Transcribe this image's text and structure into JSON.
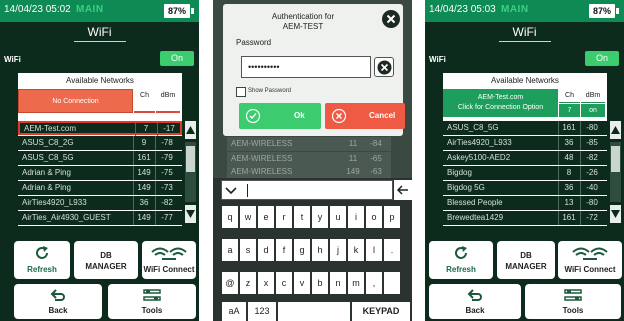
{
  "screens": [
    {
      "status": {
        "time": "14/04/23 05:02",
        "mode": "MAIN",
        "battery": "87%"
      },
      "title": "WiFi",
      "wifi_label": "WiFi",
      "toggle": "On",
      "networks": {
        "heading": "Available Networks",
        "header_left": "No Connection",
        "col_ch": "Ch",
        "col_dbm": "dBm",
        "rows": [
          {
            "name": "AEM-Test.com",
            "ch": "7",
            "dbm": "-17"
          },
          {
            "name": "ASUS_C8_2G",
            "ch": "9",
            "dbm": "-78"
          },
          {
            "name": "ASUS_C8_5G",
            "ch": "161",
            "dbm": "-79"
          },
          {
            "name": "Adrian & Ping",
            "ch": "149",
            "dbm": "-75"
          },
          {
            "name": "Adrian & Ping",
            "ch": "149",
            "dbm": "-73"
          },
          {
            "name": "AirTies4920_L933",
            "ch": "36",
            "dbm": "-82"
          },
          {
            "name": "AirTies_Air4930_GUEST",
            "ch": "149",
            "dbm": "-77"
          }
        ]
      },
      "buttons": {
        "refresh": "Refresh",
        "db_line1": "DB",
        "db_line2": "MANAGER",
        "wifi_connect": "WiFi Connect",
        "back": "Back",
        "tools": "Tools"
      }
    },
    {
      "dialog": {
        "title_line1": "Authentication for",
        "title_line2": "AEM-TEST",
        "password_label": "Password",
        "password_value": "••••••••••",
        "show_password": "Show Password",
        "ok": "Ok",
        "cancel": "Cancel"
      },
      "background_rows": [
        {
          "name": "AEM-WIRELESS",
          "ch": "11",
          "dbm": "-84"
        },
        {
          "name": "AEM-WIRELESS",
          "ch": "11",
          "dbm": "-65"
        },
        {
          "name": "AEM-WIRELESS",
          "ch": "149",
          "dbm": "-63"
        }
      ],
      "keyboard": {
        "row1": [
          "q",
          "w",
          "e",
          "r",
          "t",
          "y",
          "u",
          "i",
          "o",
          "p"
        ],
        "row2": [
          "a",
          "s",
          "d",
          "f",
          "g",
          "h",
          "j",
          "k",
          "l",
          "."
        ],
        "row3": [
          "@",
          "z",
          "x",
          "c",
          "v",
          "b",
          "n",
          "m",
          ","
        ],
        "row4_left": "aA",
        "row4_num": "123",
        "row4_right": "KEYPAD"
      }
    },
    {
      "status": {
        "time": "14/04/23 05:03",
        "mode": "MAIN",
        "battery": "87%"
      },
      "title": "WiFi",
      "wifi_label": "WiFi",
      "toggle": "On",
      "networks": {
        "heading": "Available Networks",
        "header_left_line1": "AEM-Test.com",
        "header_left_line2": "Click for Connection Option",
        "col_ch": "Ch",
        "col_dbm": "dBm",
        "sub_ch": "7",
        "sub_dbm": "on",
        "rows": [
          {
            "name": "ASUS_C8_5G",
            "ch": "161",
            "dbm": "-80"
          },
          {
            "name": "AirTies4920_L933",
            "ch": "36",
            "dbm": "-85"
          },
          {
            "name": "Askey5100-AED2",
            "ch": "48",
            "dbm": "-82"
          },
          {
            "name": "Bigdog",
            "ch": "8",
            "dbm": "-26"
          },
          {
            "name": "Bigdog 5G",
            "ch": "36",
            "dbm": "-40"
          },
          {
            "name": "Blessed People",
            "ch": "13",
            "dbm": "-80"
          },
          {
            "name": "Brewedtea1429",
            "ch": "161",
            "dbm": "-72"
          }
        ]
      },
      "buttons": {
        "refresh": "Refresh",
        "db_line1": "DB",
        "db_line2": "MANAGER",
        "wifi_connect": "WiFi Connect",
        "back": "Back",
        "tools": "Tools"
      }
    }
  ]
}
